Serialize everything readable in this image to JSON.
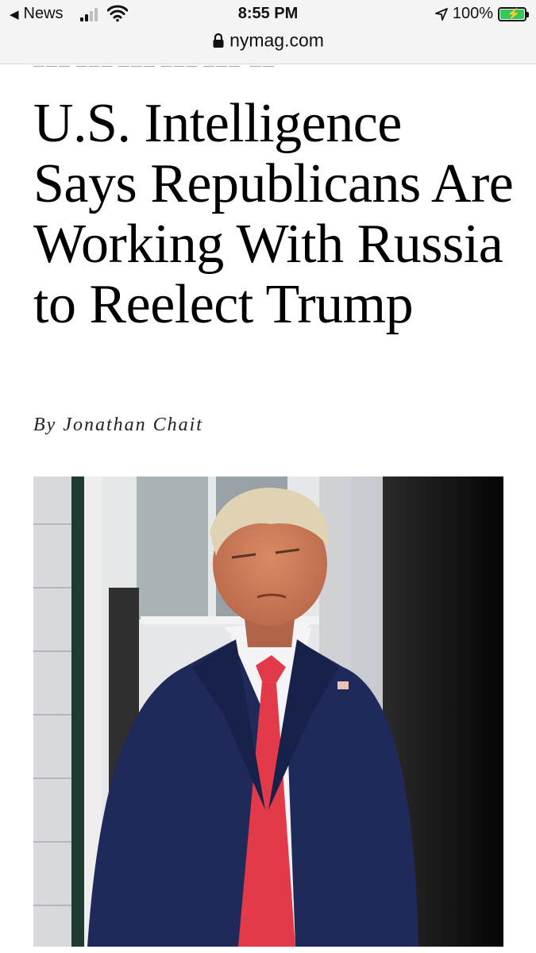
{
  "status_bar": {
    "back_label": "News",
    "time": "8:55 PM",
    "battery": "100%",
    "signal_bars_filled": 2,
    "signal_bars_total": 4,
    "battery_charging": true,
    "battery_level_fraction": 1.0,
    "icons": [
      "back-arrow-icon",
      "cellular-signal-icon",
      "wifi-icon",
      "location-arrow-icon",
      "battery-icon",
      "lock-icon"
    ]
  },
  "address_bar": {
    "domain": "nymag.com"
  },
  "article": {
    "headline": "U.S. Intelligence Says Republicans Are Working With Russia to Reelect Trump",
    "byline": "By Jonathan Chait"
  },
  "colors": {
    "battery_fill": "#34c759",
    "status_bar_bg": "#f4f4f5",
    "suit": "#1f2a5a",
    "tie": "#e23a48"
  }
}
